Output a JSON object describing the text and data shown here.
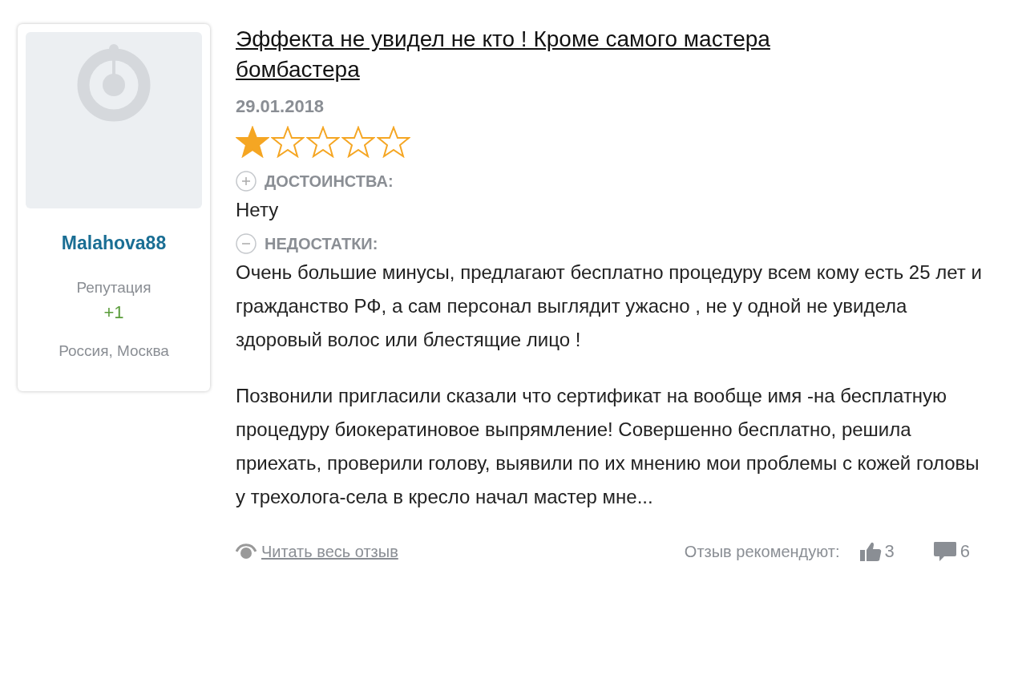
{
  "author": {
    "name": "Malahova88",
    "reputation_label": "Репутация",
    "reputation": "+1",
    "location": "Россия, Москва"
  },
  "review": {
    "title": "Эффекта не увидел не кто ! Кроме самого мастера бомбастера",
    "date": "29.01.2018",
    "stars": 1,
    "pros": {
      "label": "ДОСТОИНСТВА:",
      "text": "Нету"
    },
    "cons": {
      "label": "НЕДОСТАТКИ:",
      "paragraphs": [
        "Очень большие минусы, предлагают бесплатно процедуру всем кому есть 25 лет и гражданство РФ, а сам персонал выглядит ужасно , не у одной не увидела здоровый волос или блестящие лицо !",
        "Позвонили пригласили сказали что сертификат на вообще имя -на бесплатную процедуру биокератиновое выпрямление! Совершенно бесплатно, решила приехать, проверили голову, выявили по их мнению мои проблемы с кожей головы у трехолога-села в кресло начал мастер мне..."
      ]
    },
    "read_more": "Читать весь отзыв",
    "recommend_label": "Отзыв рекомендуют:",
    "likes": "3",
    "comments": "6"
  }
}
